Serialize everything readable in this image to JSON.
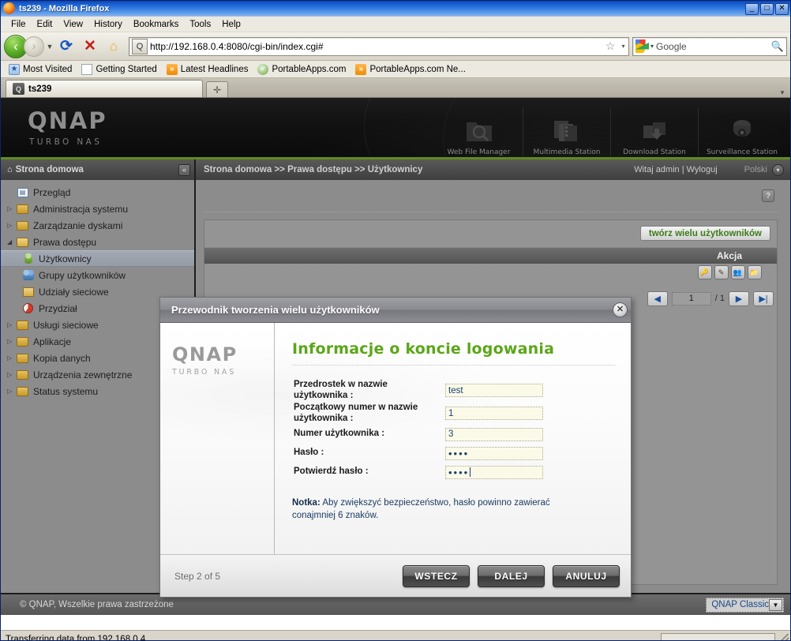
{
  "window": {
    "title": "ts239 - Mozilla Firefox",
    "minimize": "_",
    "maximize": "□",
    "close": "✕"
  },
  "menu": {
    "items": [
      "File",
      "Edit",
      "View",
      "History",
      "Bookmarks",
      "Tools",
      "Help"
    ]
  },
  "toolbar": {
    "back_icon": "‹",
    "forward_icon": "›",
    "dropdown_icon": "▼",
    "reload_icon": "⟳",
    "stop_icon": "✕",
    "home_icon": "⌂",
    "site_icon": "Q",
    "url": "http://192.168.0.4:8080/cgi-bin/index.cgi#",
    "star_icon": "☆",
    "star_dropdown": "▾",
    "search_engine": "google-icon",
    "search_dropdown": "▾",
    "search_placeholder": "Google",
    "search_icon": "🔍"
  },
  "bookmarks": [
    {
      "label": "Most Visited",
      "icon": "folder"
    },
    {
      "label": "Getting Started",
      "icon": "page"
    },
    {
      "label": "Latest Headlines",
      "icon": "rss"
    },
    {
      "label": "PortableApps.com",
      "icon": "check"
    },
    {
      "label": "PortableApps.com Ne...",
      "icon": "rss"
    }
  ],
  "tabs": {
    "active": {
      "label": "ts239",
      "icon": "Q"
    },
    "new_tab_icon": "✛",
    "list_all_icon": "▾"
  },
  "banner": {
    "logo": "QNAP",
    "sublogo": "TURBO NAS",
    "apps": [
      {
        "label": "Web File Manager",
        "icon": "web-file-manager-icon"
      },
      {
        "label": "Multimedia Station",
        "icon": "multimedia-station-icon"
      },
      {
        "label": "Download Station",
        "icon": "download-station-icon"
      },
      {
        "label": "Surveillance Station",
        "icon": "surveillance-station-icon"
      }
    ]
  },
  "navrow": {
    "home_icon": "⌂",
    "home_label": "Strona domowa",
    "collapse_icon": "«",
    "breadcrumb": "Strona domowa >> Prawa dostępu >> Użytkownicy",
    "greeting": "Witaj admin | Wyloguj",
    "language": "Polski",
    "language_dropdown": "▾"
  },
  "sidebar": {
    "items": [
      {
        "label": "Przegląd",
        "level": 1,
        "icon": "doc",
        "arrow": false,
        "selected": false
      },
      {
        "label": "Administracja systemu",
        "level": 1,
        "icon": "folder",
        "arrow": "▷",
        "selected": false
      },
      {
        "label": "Zarządzanie dyskami",
        "level": 1,
        "icon": "folder",
        "arrow": "▷",
        "selected": false
      },
      {
        "label": "Prawa dostępu",
        "level": 1,
        "icon": "folder-open",
        "arrow": "◢",
        "selected": false
      },
      {
        "label": "Użytkownicy",
        "level": 2,
        "icon": "user",
        "arrow": false,
        "selected": true
      },
      {
        "label": "Grupy użytkowników",
        "level": 2,
        "icon": "group",
        "arrow": false,
        "selected": false
      },
      {
        "label": "Udziały sieciowe",
        "level": 2,
        "icon": "share",
        "arrow": false,
        "selected": false
      },
      {
        "label": "Przydział",
        "level": 2,
        "icon": "quota",
        "arrow": false,
        "selected": false
      },
      {
        "label": "Usługi sieciowe",
        "level": 1,
        "icon": "folder",
        "arrow": "▷",
        "selected": false
      },
      {
        "label": "Aplikacje",
        "level": 1,
        "icon": "folder",
        "arrow": "▷",
        "selected": false
      },
      {
        "label": "Kopia danych",
        "level": 1,
        "icon": "folder",
        "arrow": "▷",
        "selected": false
      },
      {
        "label": "Urządzenia zewnętrzne",
        "level": 1,
        "icon": "folder",
        "arrow": "▷",
        "selected": false
      },
      {
        "label": "Status systemu",
        "level": 1,
        "icon": "folder",
        "arrow": "▷",
        "selected": false
      }
    ]
  },
  "content": {
    "help_icon": "?",
    "create_button": "twórz wielu użytkowników",
    "table_header_action": "Akcja",
    "action_icons": [
      "key-icon",
      "edit-icon",
      "group-icon",
      "share-icon"
    ],
    "pager": {
      "page_value": "1",
      "of_label": "/ 1",
      "prev_icon": "◀",
      "next_icon": "▶",
      "last_icon": "▶|"
    }
  },
  "page_footer": {
    "copyright": "© QNAP, Wszelkie prawa zastrzeżone",
    "theme": "QNAP Classic",
    "theme_arrow": "▼"
  },
  "dialog": {
    "title": "Przewodnik tworzenia wielu użytkowników",
    "close_icon": "✕",
    "logo": "QNAP",
    "sublogo": "TURBO NAS",
    "heading": "Informacje o koncie logowania",
    "fields": [
      {
        "label": "Przedrostek w nazwie użytkownika  :",
        "value": "test",
        "type": "text"
      },
      {
        "label": "Początkowy numer w nazwie użytkownika  :",
        "value": "1",
        "type": "text"
      },
      {
        "label": "Numer użytkownika  :",
        "value": "3",
        "type": "text"
      },
      {
        "label": "Hasło  :",
        "value": "••••",
        "type": "password"
      },
      {
        "label": "Potwierdź hasło  :",
        "value": "••••",
        "type": "password"
      }
    ],
    "note_label": "Notka:",
    "note_text": " Aby zwiększyć bezpieczeństwo, hasło powinno zawierać conajmniej 6 znaków.",
    "step_counter": "Step 2 of 5",
    "buttons": {
      "back": "WSTECZ",
      "next": "DALEJ",
      "cancel": "ANULUJ"
    }
  },
  "statusbar": {
    "text": "Transferring data from 192.168.0.4..."
  }
}
